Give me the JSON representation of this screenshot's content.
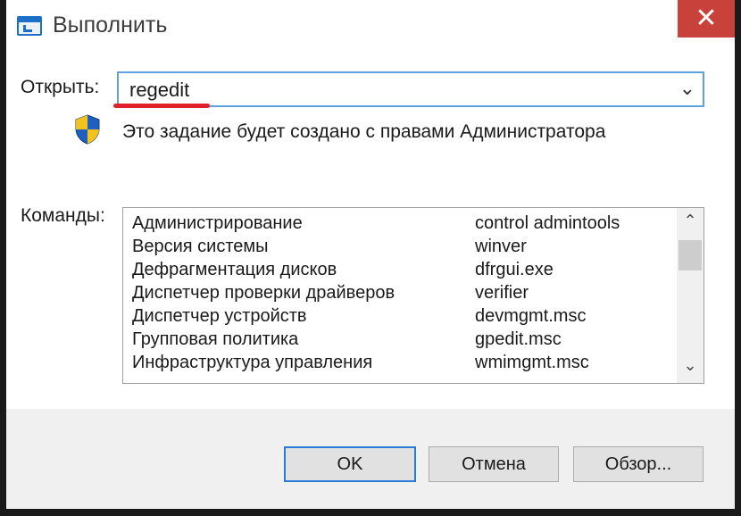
{
  "window": {
    "title": "Выполнить",
    "close_glyph": "✕"
  },
  "open": {
    "label": "Открыть:",
    "value": "regedit"
  },
  "admin_notice": "Это задание будет создано с правами Администратора",
  "commands": {
    "label": "Команды:",
    "items": [
      {
        "name": "Администрирование",
        "command": "control admintools"
      },
      {
        "name": "Версия системы",
        "command": "winver"
      },
      {
        "name": "Дефрагментация дисков",
        "command": "dfrgui.exe"
      },
      {
        "name": "Диспетчер проверки драйверов",
        "command": "verifier"
      },
      {
        "name": "Диспетчер устройств",
        "command": "devmgmt.msc"
      },
      {
        "name": "Групповая политика",
        "command": "gpedit.msc"
      },
      {
        "name": "Инфраструктура управления",
        "command": "wmimgmt.msc"
      }
    ]
  },
  "buttons": {
    "ok": "OK",
    "cancel": "Отмена",
    "browse": "Обзор..."
  },
  "colors": {
    "accent": "#5ea3df",
    "close": "#c8413a",
    "highlight": "#e0202a"
  }
}
